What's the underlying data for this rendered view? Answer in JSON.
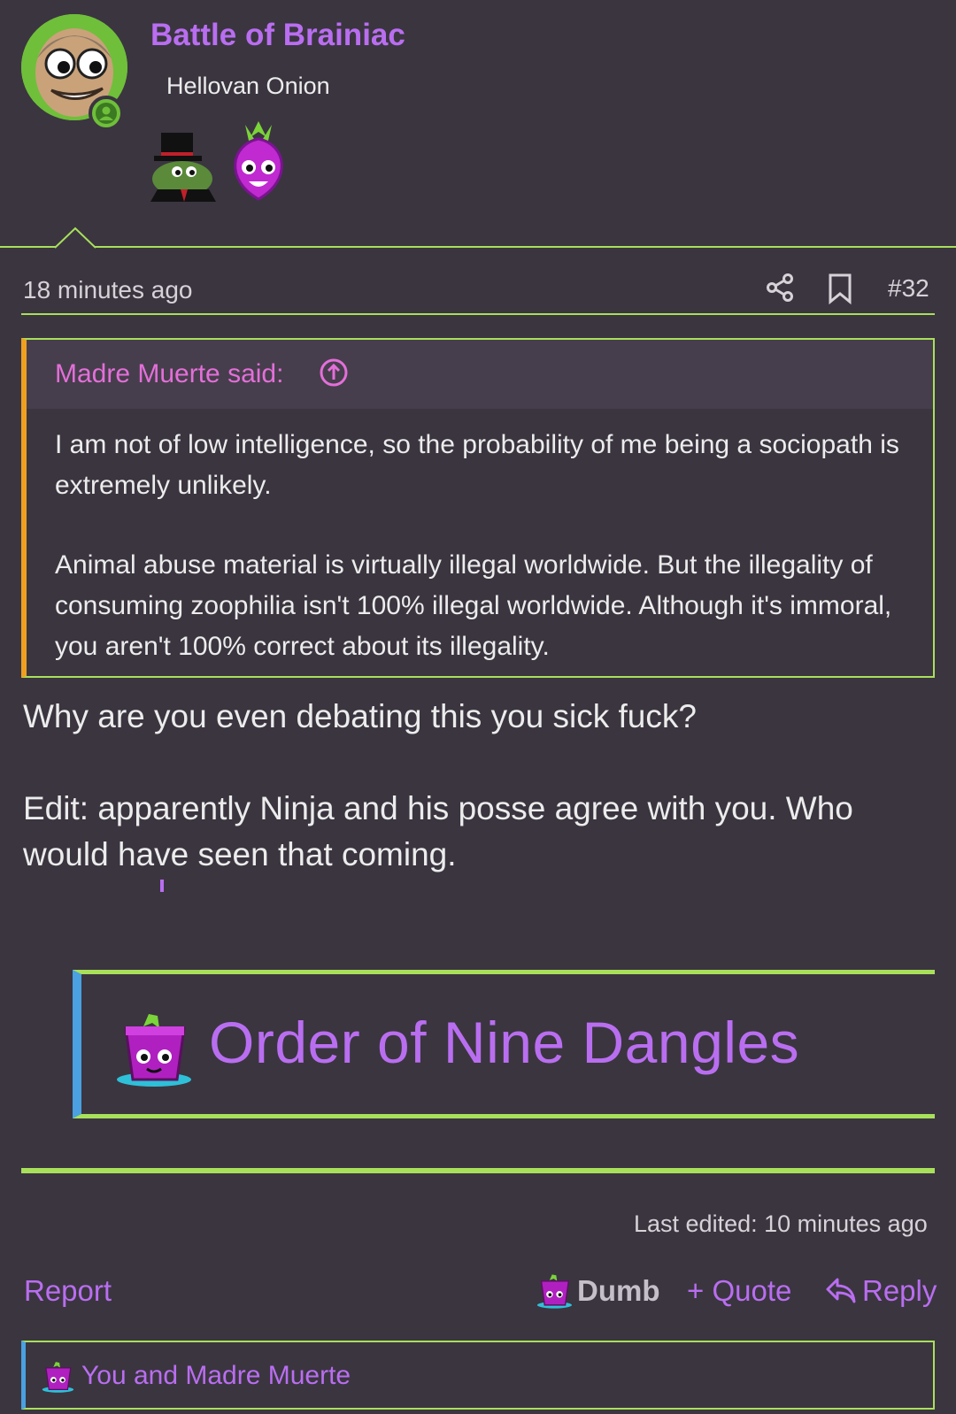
{
  "user": {
    "name": "Battle of Brainiac",
    "title": "Hellovan Onion"
  },
  "post": {
    "time": "18 minutes ago",
    "number": "#32",
    "quote": {
      "author": "Madre Muerte said:",
      "paragraphs": [
        "I am not of low intelligence, so the probability of me being a sociopath is extremely unlikely.",
        "Animal abuse material is virtually illegal worldwide. But the illegality of consuming zoophilia isn't 100% illegal worldwide. Although it's immoral, you aren't 100% correct about its illegality."
      ]
    },
    "body": [
      "Why are you even debating this you sick fuck?",
      "Edit: apparently Ninja and his posse agree with you. Who would have seen that coming."
    ],
    "signature": "Order of Nine Dangles",
    "last_edited": "Last edited: 10 minutes ago"
  },
  "actions": {
    "report": "Report",
    "dumb": "Dumb",
    "quote": "+ Quote",
    "reply": "Reply"
  },
  "reactions": {
    "text": "You and Madre Muerte"
  },
  "colors": {
    "background": "#3b3540",
    "accent_green": "#a8e05a",
    "accent_purple": "#b96ef0",
    "quote_author": "#e36fd9",
    "quote_border": "#f0a020",
    "sig_border": "#4aa0e0"
  }
}
